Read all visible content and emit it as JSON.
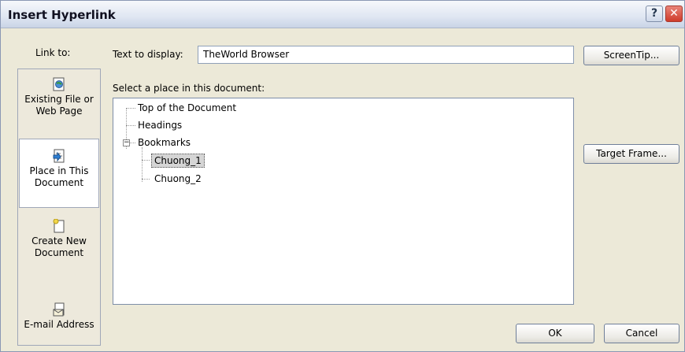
{
  "window": {
    "title": "Insert Hyperlink",
    "help_glyph": "?",
    "close_glyph": "✕"
  },
  "link_to": {
    "label": "Link to:",
    "items": [
      {
        "line1": "Existing File or",
        "line2": "Web Page",
        "icon": "web-file-icon"
      },
      {
        "line1": "Place in This",
        "line2": "Document",
        "icon": "document-place-icon"
      },
      {
        "line1": "Create New",
        "line2": "Document",
        "icon": "new-document-icon"
      },
      {
        "line1": "E-mail Address",
        "line2": "",
        "icon": "email-icon"
      }
    ]
  },
  "display": {
    "label": "Text to display:",
    "value": "TheWorld Browser"
  },
  "buttons": {
    "screentip": "ScreenTip...",
    "target_frame": "Target Frame...",
    "ok": "OK",
    "cancel": "Cancel"
  },
  "place": {
    "label": "Select a place in this document:",
    "tree": {
      "top": "Top of the Document",
      "headings": "Headings",
      "bookmarks": "Bookmarks",
      "bookmark_items": [
        "Chuong_1",
        "Chuong_2"
      ],
      "selected": "Chuong_1"
    }
  },
  "colors": {
    "dialog_bg": "#ece9d8",
    "close_button": "#cf3b2a",
    "selection": "#d5d5d5"
  }
}
